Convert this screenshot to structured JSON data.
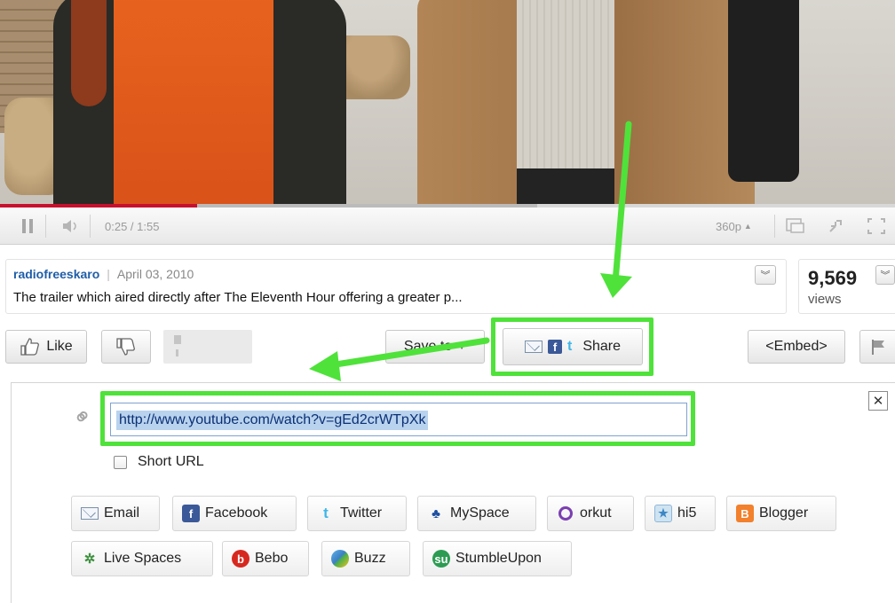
{
  "player": {
    "time": "0:25 / 1:55",
    "quality": "360p",
    "progress_played": 0.22,
    "progress_loaded": 0.6
  },
  "info": {
    "uploader": "radiofreeskaro",
    "separator": "|",
    "date": "April 03, 2010",
    "description": "The trailer which aired directly after The Eleventh Hour offering a greater p...",
    "views_count": "9,569",
    "views_label": "views"
  },
  "actions": {
    "like": "Like",
    "save_to": "Save to",
    "share": "Share",
    "embed": "<Embed>"
  },
  "share_panel": {
    "url": "http://www.youtube.com/watch?v=gEd2crWTpXk",
    "short_url_label": "Short URL",
    "services_row1": [
      "Email",
      "Facebook",
      "Twitter",
      "MySpace",
      "orkut",
      "hi5",
      "Blogger"
    ],
    "services_row2": [
      "Live Spaces",
      "Bebo",
      "Buzz",
      "StumbleUpon"
    ]
  },
  "colors": {
    "highlight": "#4fe23a",
    "progress_red": "#c8102e",
    "link_blue": "#1f5ea8"
  }
}
